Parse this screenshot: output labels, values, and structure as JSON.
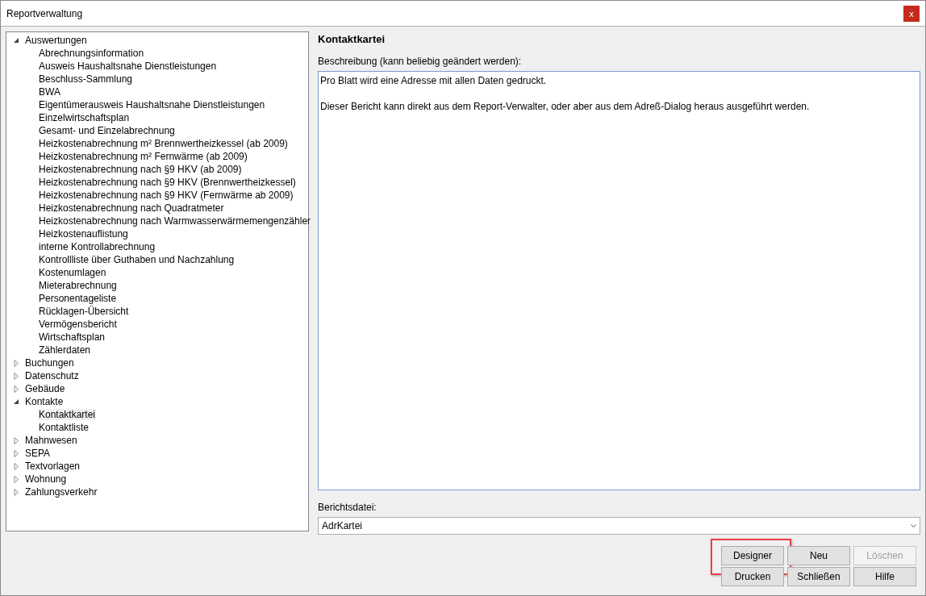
{
  "window": {
    "title": "Reportverwaltung",
    "close": "x"
  },
  "tree": [
    {
      "label": "Auswertungen",
      "expanded": true,
      "children": [
        {
          "label": "Abrechnungsinformation",
          "selected": false
        },
        {
          "label": "Ausweis Haushaltsnahe Dienstleistungen",
          "selected": false
        },
        {
          "label": "Beschluss-Sammlung",
          "selected": false
        },
        {
          "label": "BWA",
          "selected": false
        },
        {
          "label": "Eigentümerausweis Haushaltsnahe Dienstleistungen",
          "selected": false
        },
        {
          "label": "Einzelwirtschaftsplan",
          "selected": false
        },
        {
          "label": "Gesamt- und Einzelabrechnung",
          "selected": false
        },
        {
          "label": "Heizkostenabrechnung m² Brennwertheizkessel (ab 2009)",
          "selected": false
        },
        {
          "label": "Heizkostenabrechnung m² Fernwärme (ab 2009)",
          "selected": false
        },
        {
          "label": "Heizkostenabrechnung nach §9 HKV (ab 2009)",
          "selected": false
        },
        {
          "label": "Heizkostenabrechnung nach §9 HKV (Brennwertheizkessel)",
          "selected": false
        },
        {
          "label": "Heizkostenabrechnung nach §9 HKV (Fernwärme ab 2009)",
          "selected": false
        },
        {
          "label": "Heizkostenabrechnung nach Quadratmeter",
          "selected": false
        },
        {
          "label": "Heizkostenabrechnung nach Warmwasserwärmemengenzähler",
          "selected": false
        },
        {
          "label": "Heizkostenauflistung",
          "selected": false
        },
        {
          "label": "interne Kontrollabrechnung",
          "selected": false
        },
        {
          "label": "Kontrollliste über Guthaben und Nachzahlung",
          "selected": false
        },
        {
          "label": "Kostenumlagen",
          "selected": false
        },
        {
          "label": "Mieterabrechnung",
          "selected": false
        },
        {
          "label": "Personentageliste",
          "selected": false
        },
        {
          "label": "Rücklagen-Übersicht",
          "selected": false
        },
        {
          "label": "Vermögensbericht",
          "selected": false
        },
        {
          "label": "Wirtschaftsplan",
          "selected": false
        },
        {
          "label": "Zählerdaten",
          "selected": false
        }
      ]
    },
    {
      "label": "Buchungen",
      "expanded": false
    },
    {
      "label": "Datenschutz",
      "expanded": false
    },
    {
      "label": "Gebäude",
      "expanded": false
    },
    {
      "label": "Kontakte",
      "expanded": true,
      "children": [
        {
          "label": "Kontaktkartei",
          "selected": true
        },
        {
          "label": "Kontaktliste",
          "selected": false
        }
      ]
    },
    {
      "label": "Mahnwesen",
      "expanded": false
    },
    {
      "label": "SEPA",
      "expanded": false
    },
    {
      "label": "Textvorlagen",
      "expanded": false
    },
    {
      "label": "Wohnung",
      "expanded": false
    },
    {
      "label": "Zahlungsverkehr",
      "expanded": false
    }
  ],
  "detail": {
    "heading": "Kontaktkartei",
    "description_label": "Beschreibung (kann beliebig geändert werden):",
    "description": [
      "Pro Blatt wird eine Adresse mit allen Daten gedruckt.",
      "Dieser Bericht kann direkt aus dem Report-Verwalter, oder aber aus dem Adreß-Dialog heraus ausgeführt werden."
    ],
    "file_label": "Berichtsdatei:",
    "file_value": "AdrKartei"
  },
  "buttons": [
    {
      "label": "Designer",
      "disabled": false,
      "highlighted": true
    },
    {
      "label": "Neu",
      "disabled": false,
      "highlighted": false
    },
    {
      "label": "Löschen",
      "disabled": true,
      "highlighted": false
    },
    {
      "label": "Drucken",
      "disabled": false,
      "highlighted": false
    },
    {
      "label": "Schließen",
      "disabled": false,
      "highlighted": false
    },
    {
      "label": "Hilfe",
      "disabled": false,
      "highlighted": false
    }
  ]
}
